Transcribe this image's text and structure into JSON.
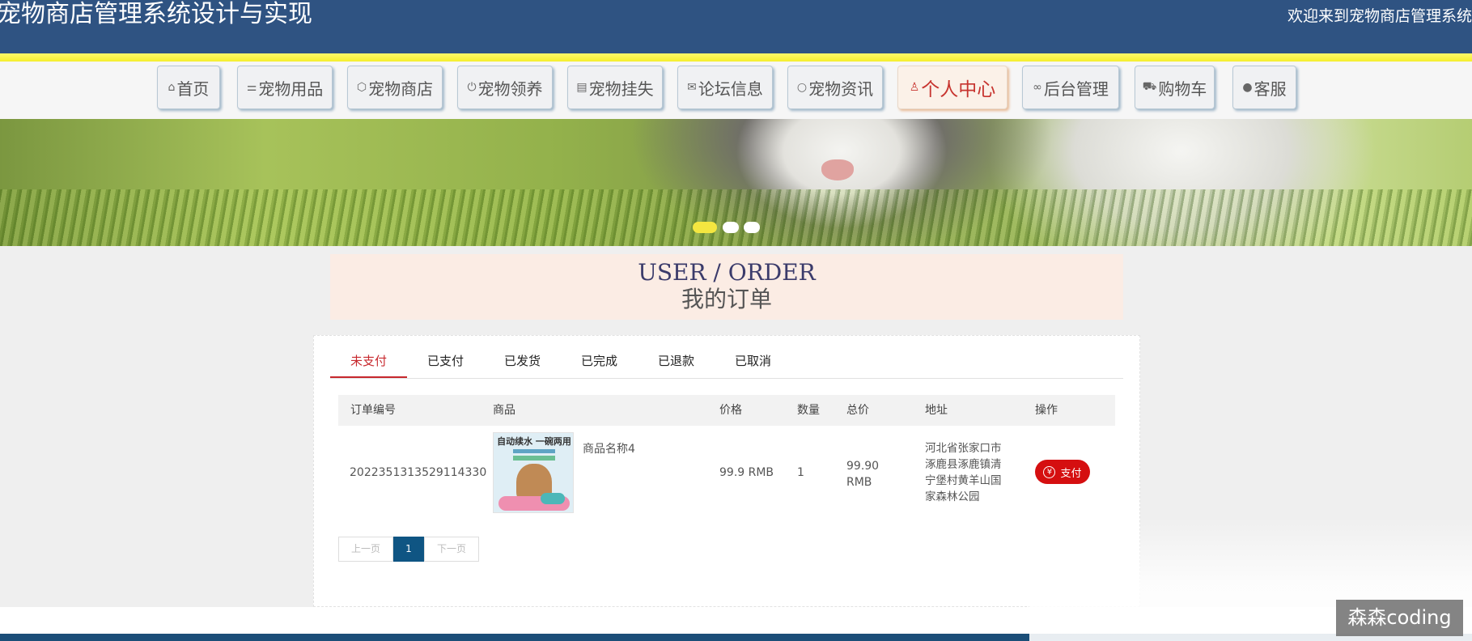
{
  "header": {
    "title": "宠物商店管理系统设计与实现",
    "welcome": "欢迎来到宠物商店管理系统"
  },
  "nav": {
    "items": [
      {
        "label": "首页",
        "icon": "home-icon",
        "glyph": "⌂"
      },
      {
        "label": "宠物用品",
        "icon": "sliders-icon",
        "glyph": "⚌"
      },
      {
        "label": "宠物商店",
        "icon": "cube-icon",
        "glyph": "⬡"
      },
      {
        "label": "宠物领养",
        "icon": "power-icon",
        "glyph": "⏻"
      },
      {
        "label": "宠物挂失",
        "icon": "clipboard-icon",
        "glyph": "▤"
      },
      {
        "label": "论坛信息",
        "icon": "mail-icon",
        "glyph": "✉"
      },
      {
        "label": "宠物资讯",
        "icon": "circle-icon",
        "glyph": "○"
      },
      {
        "label": "个人中心",
        "icon": "user-icon",
        "glyph": "♙"
      },
      {
        "label": "后台管理",
        "icon": "link-icon",
        "glyph": "∞"
      },
      {
        "label": "购物车",
        "icon": "cart-icon",
        "glyph": "⛟"
      },
      {
        "label": "客服",
        "icon": "chat-icon",
        "glyph": "●"
      }
    ],
    "active_index": 7
  },
  "banner": {
    "active_slide": 1,
    "slide_count": 3
  },
  "order_header": {
    "en": "USER / ORDER",
    "cn": "我的订单"
  },
  "tabs": {
    "items": [
      "未支付",
      "已支付",
      "已发货",
      "已完成",
      "已退款",
      "已取消"
    ],
    "active_index": 0
  },
  "table": {
    "columns": [
      "订单编号",
      "商品",
      "价格",
      "数量",
      "总价",
      "地址",
      "操作"
    ],
    "rows": [
      {
        "order_no": "2022351313529114330",
        "product_image_text": "自动续水 一碗两用",
        "product_name": "商品名称4",
        "price": "99.9 RMB",
        "quantity": "1",
        "total_line1": "99.90",
        "total_line2": "RMB",
        "address_lines": [
          "河北省张家口市",
          "涿鹿县涿鹿镇清",
          "宁堡村黄羊山国",
          "家森林公园"
        ],
        "action_label": "支付"
      }
    ]
  },
  "pagination": {
    "prev": "上一页",
    "current": "1",
    "next": "下一页"
  },
  "watermark": "森森coding",
  "colors": {
    "header_bg": "#2f5382",
    "accent_yellow": "#f5ef2e",
    "active_red": "#c7282d",
    "pay_button": "#d50f10",
    "pager_active": "#0f5583"
  }
}
